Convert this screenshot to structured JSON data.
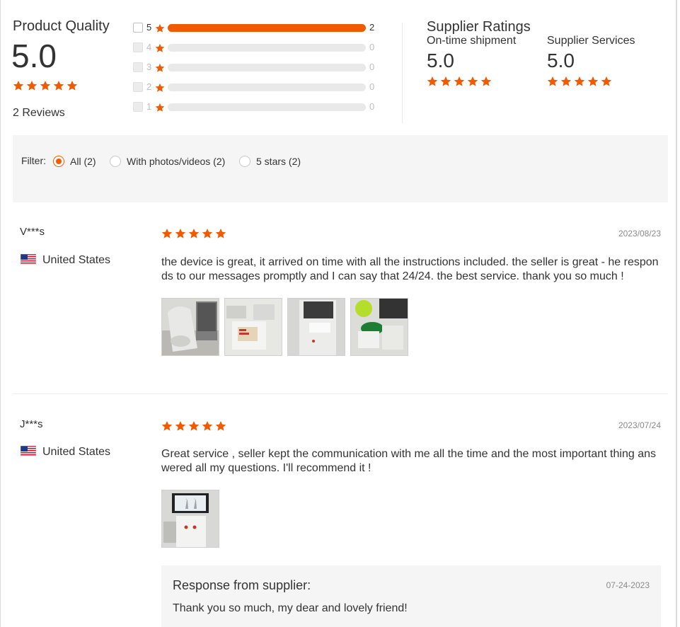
{
  "product_quality": {
    "title": "Product Quality",
    "score": "5.0",
    "stars": 5,
    "reviews_label": "2 Reviews"
  },
  "histogram": [
    {
      "star": "5",
      "count": "2",
      "fraction": 1.0
    },
    {
      "star": "4",
      "count": "0",
      "fraction": 0
    },
    {
      "star": "3",
      "count": "0",
      "fraction": 0
    },
    {
      "star": "2",
      "count": "0",
      "fraction": 0
    },
    {
      "star": "1",
      "count": "0",
      "fraction": 0
    }
  ],
  "supplier_ratings": {
    "title": "Supplier Ratings",
    "shipment_label": "On-time shipment",
    "shipment_score": "5.0",
    "services_label": "Supplier Services",
    "services_score": "5.0"
  },
  "filter": {
    "label": "Filter:",
    "options": [
      {
        "label": "All (2)",
        "selected": true
      },
      {
        "label": "With photos/videos (2)",
        "selected": false
      },
      {
        "label": "5 stars (2)",
        "selected": false
      }
    ]
  },
  "reviews": [
    {
      "name": "V***s",
      "country": "United States",
      "stars": 5,
      "date": "2023/08/23",
      "text": "the device is great, it arrived on time with all the instructions included. the seller is great - he respon ds to our messages promptly and I can say that 24/24. the best service. thank you so much !",
      "photos": 4
    },
    {
      "name": "J***s",
      "country": "United States",
      "stars": 5,
      "date": "2023/07/24",
      "text": "Great service , seller kept the communication with me all the time and the most important thing ans wered all my questions. I'll recommend it !",
      "photos": 1
    }
  ],
  "supplier_response": {
    "title": "Response from supplier:",
    "date": "07-24-2023",
    "text": "Thank you so much, my dear and lovely friend!"
  },
  "colors": {
    "accent": "#f05a00",
    "star": "#f05a00",
    "panel": "#f5f5f5"
  }
}
